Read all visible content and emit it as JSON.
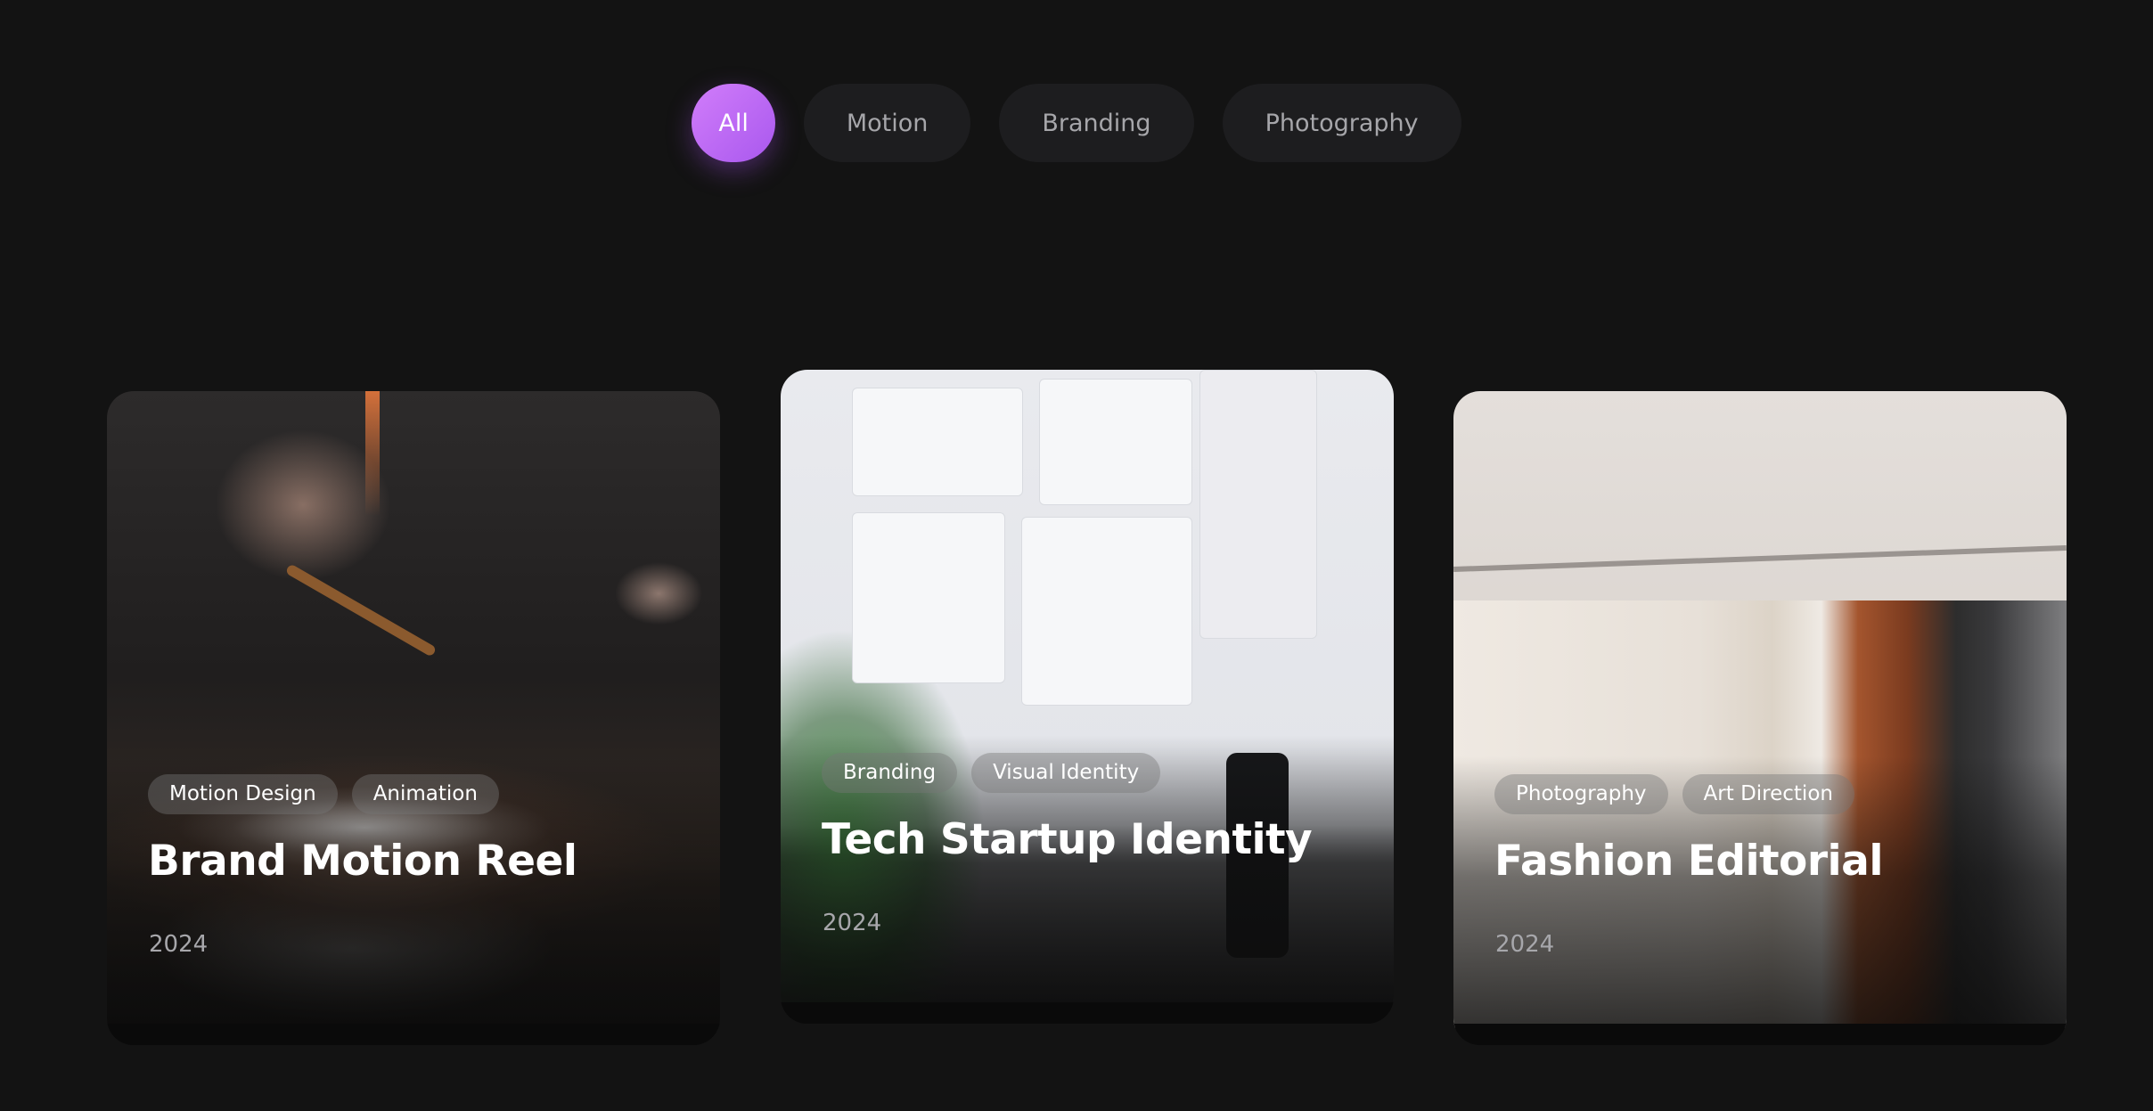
{
  "filters": {
    "items": [
      {
        "label": "All",
        "active": true
      },
      {
        "label": "Motion",
        "active": false
      },
      {
        "label": "Branding",
        "active": false
      },
      {
        "label": "Photography",
        "active": false
      }
    ]
  },
  "accent_gradient": [
    "#d17dfa",
    "#a958ee"
  ],
  "projects": [
    {
      "title": "Brand Motion Reel",
      "year": "2024",
      "tags": [
        "Motion Design",
        "Animation"
      ],
      "image": "cauldron-smoke-photo"
    },
    {
      "title": "Tech Startup Identity",
      "year": "2024",
      "tags": [
        "Branding",
        "Visual Identity"
      ],
      "image": "design-system-monitor-photo"
    },
    {
      "title": "Fashion Editorial",
      "year": "2024",
      "tags": [
        "Photography",
        "Art Direction"
      ],
      "image": "clothing-rack-photo"
    }
  ]
}
